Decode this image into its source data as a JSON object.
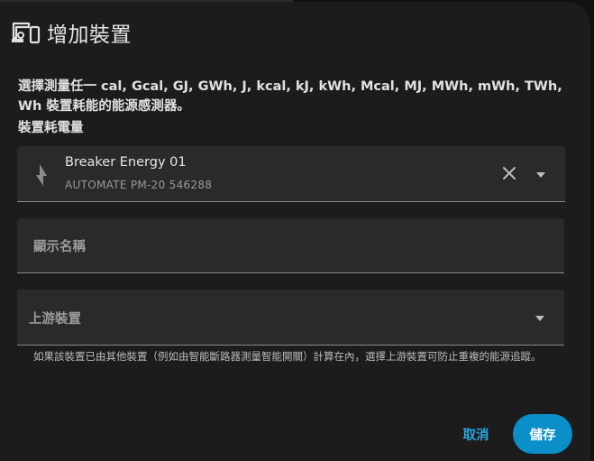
{
  "dialog": {
    "title": "增加裝置",
    "icon": "devices-icon"
  },
  "description": "選擇測量任一 cal, Gcal, GJ, GWh, J, kcal, kJ, kWh, Mcal, MJ, MWh, mWh, TWh, Wh 裝置耗能的能源感測器。",
  "section_label": "裝置耗電量",
  "device_field": {
    "icon": "flash-icon",
    "value_name": "Breaker Energy 01",
    "value_sub": "AUTOMATE PM-20 546288"
  },
  "display_name_field": {
    "placeholder": "顯示名稱",
    "value": ""
  },
  "upstream_field": {
    "placeholder": "上游裝置",
    "value": ""
  },
  "helper_text": "如果該裝置已由其他裝置（例如由智能斷路器測量智能開關）計算在內，選擇上游裝置可防止重複的能源追蹤。",
  "actions": {
    "cancel_label": "取消",
    "save_label": "儲存"
  },
  "colors": {
    "accent": "#0a8fc8",
    "link": "#26a6e0",
    "surface": "#1c1c1c",
    "field": "#2a2a2a"
  }
}
